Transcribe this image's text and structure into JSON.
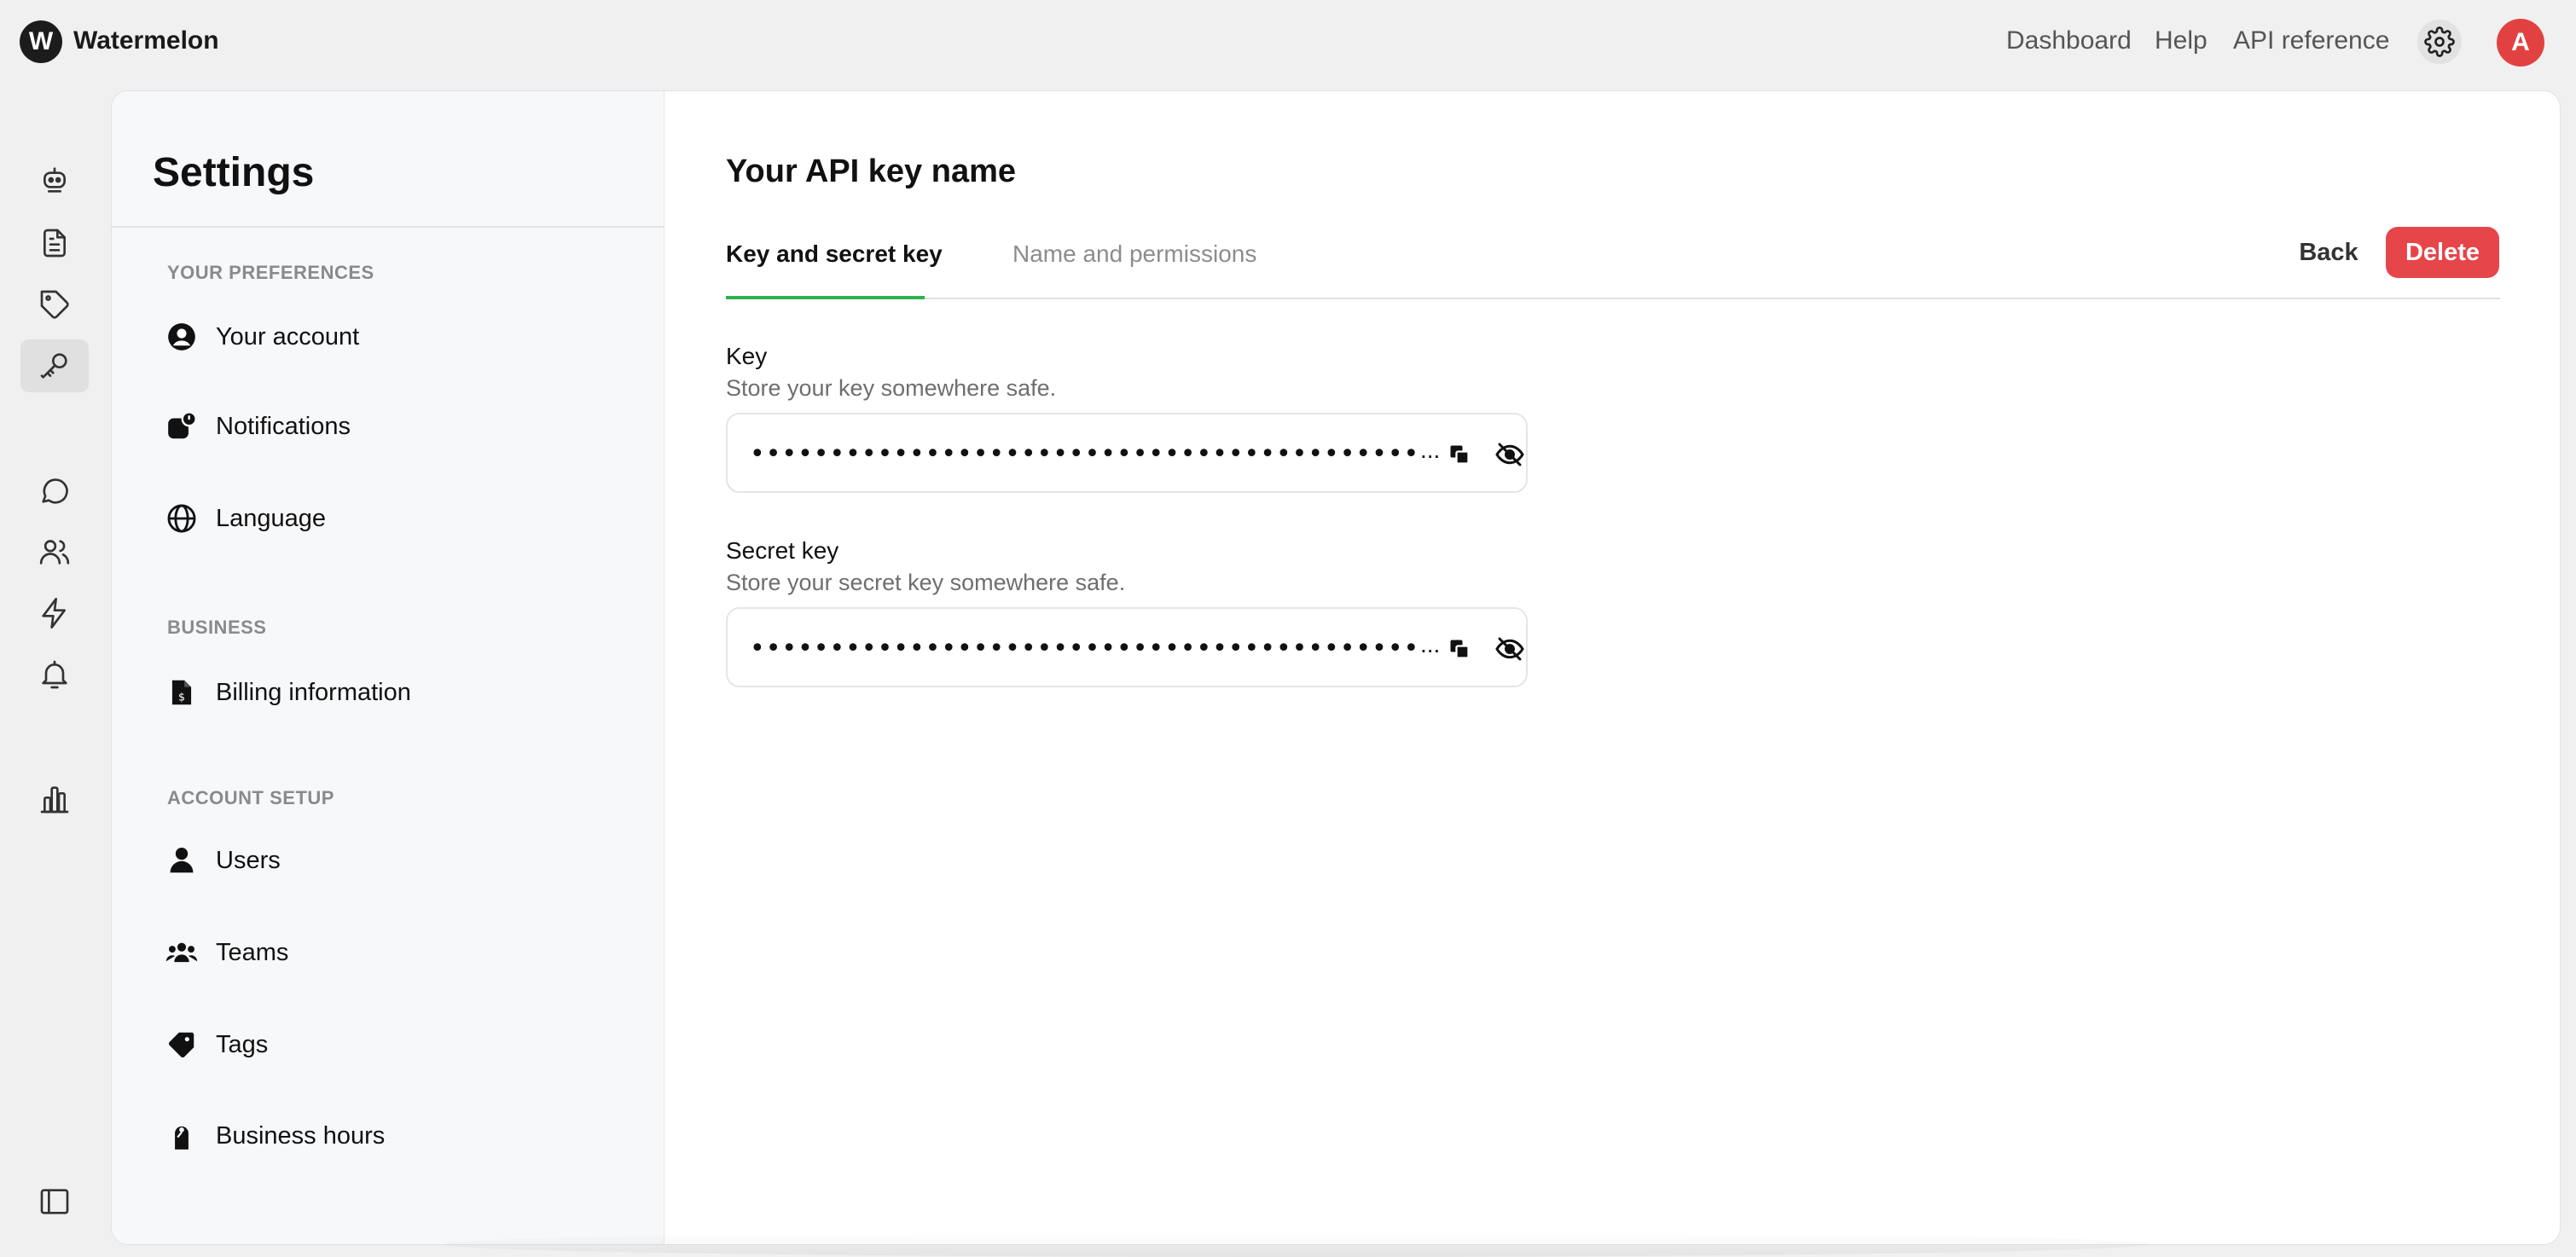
{
  "app": {
    "logo_letter": "W",
    "name": "Watermelon"
  },
  "topnav": {
    "items": [
      "Dashboard",
      "Help",
      "API reference"
    ],
    "avatar_letter": "A"
  },
  "rail": {
    "items": [
      "bot-icon",
      "document-icon",
      "tag-icon",
      "key-icon",
      "chat-icon",
      "users-icon",
      "lightning-icon",
      "bell-icon",
      "chart-icon"
    ],
    "active": "key-icon",
    "bottom": "sidebar-toggle-icon"
  },
  "settings": {
    "title": "Settings",
    "sections": [
      {
        "label": "YOUR PREFERENCES",
        "items": [
          {
            "label": "Your account",
            "icon": "account-icon"
          },
          {
            "label": "Notifications",
            "icon": "notifications-icon"
          },
          {
            "label": "Language",
            "icon": "globe-icon"
          }
        ]
      },
      {
        "label": "BUSINESS",
        "items": [
          {
            "label": "Billing information",
            "icon": "billing-icon"
          }
        ]
      },
      {
        "label": "ACCOUNT SETUP",
        "items": [
          {
            "label": "Users",
            "icon": "user-icon"
          },
          {
            "label": "Teams",
            "icon": "team-icon"
          },
          {
            "label": "Tags",
            "icon": "tag-icon"
          },
          {
            "label": "Business hours",
            "icon": "door-hanger-icon"
          }
        ]
      }
    ]
  },
  "content": {
    "title": "Your API key name",
    "tabs": [
      {
        "label": "Key and secret key",
        "active": true
      },
      {
        "label": "Name and permissions",
        "active": false
      }
    ],
    "back_label": "Back",
    "delete_label": "Delete",
    "fields": [
      {
        "label": "Key",
        "help": "Store your key somewhere safe.",
        "masked_value": "••••••••••••••••••••••••••••••••••••••••••••••••••••••••••••••",
        "ellipsis": "..."
      },
      {
        "label": "Secret key",
        "help": "Store your secret key somewhere safe.",
        "masked_value": "••••••••••••••••••••••••••••••••••••••••••••••••••••••••••••••",
        "ellipsis": "..."
      }
    ]
  },
  "colors": {
    "accent_green": "#2fb24c",
    "danger_red": "#e6454a",
    "avatar_red": "#e14141"
  }
}
